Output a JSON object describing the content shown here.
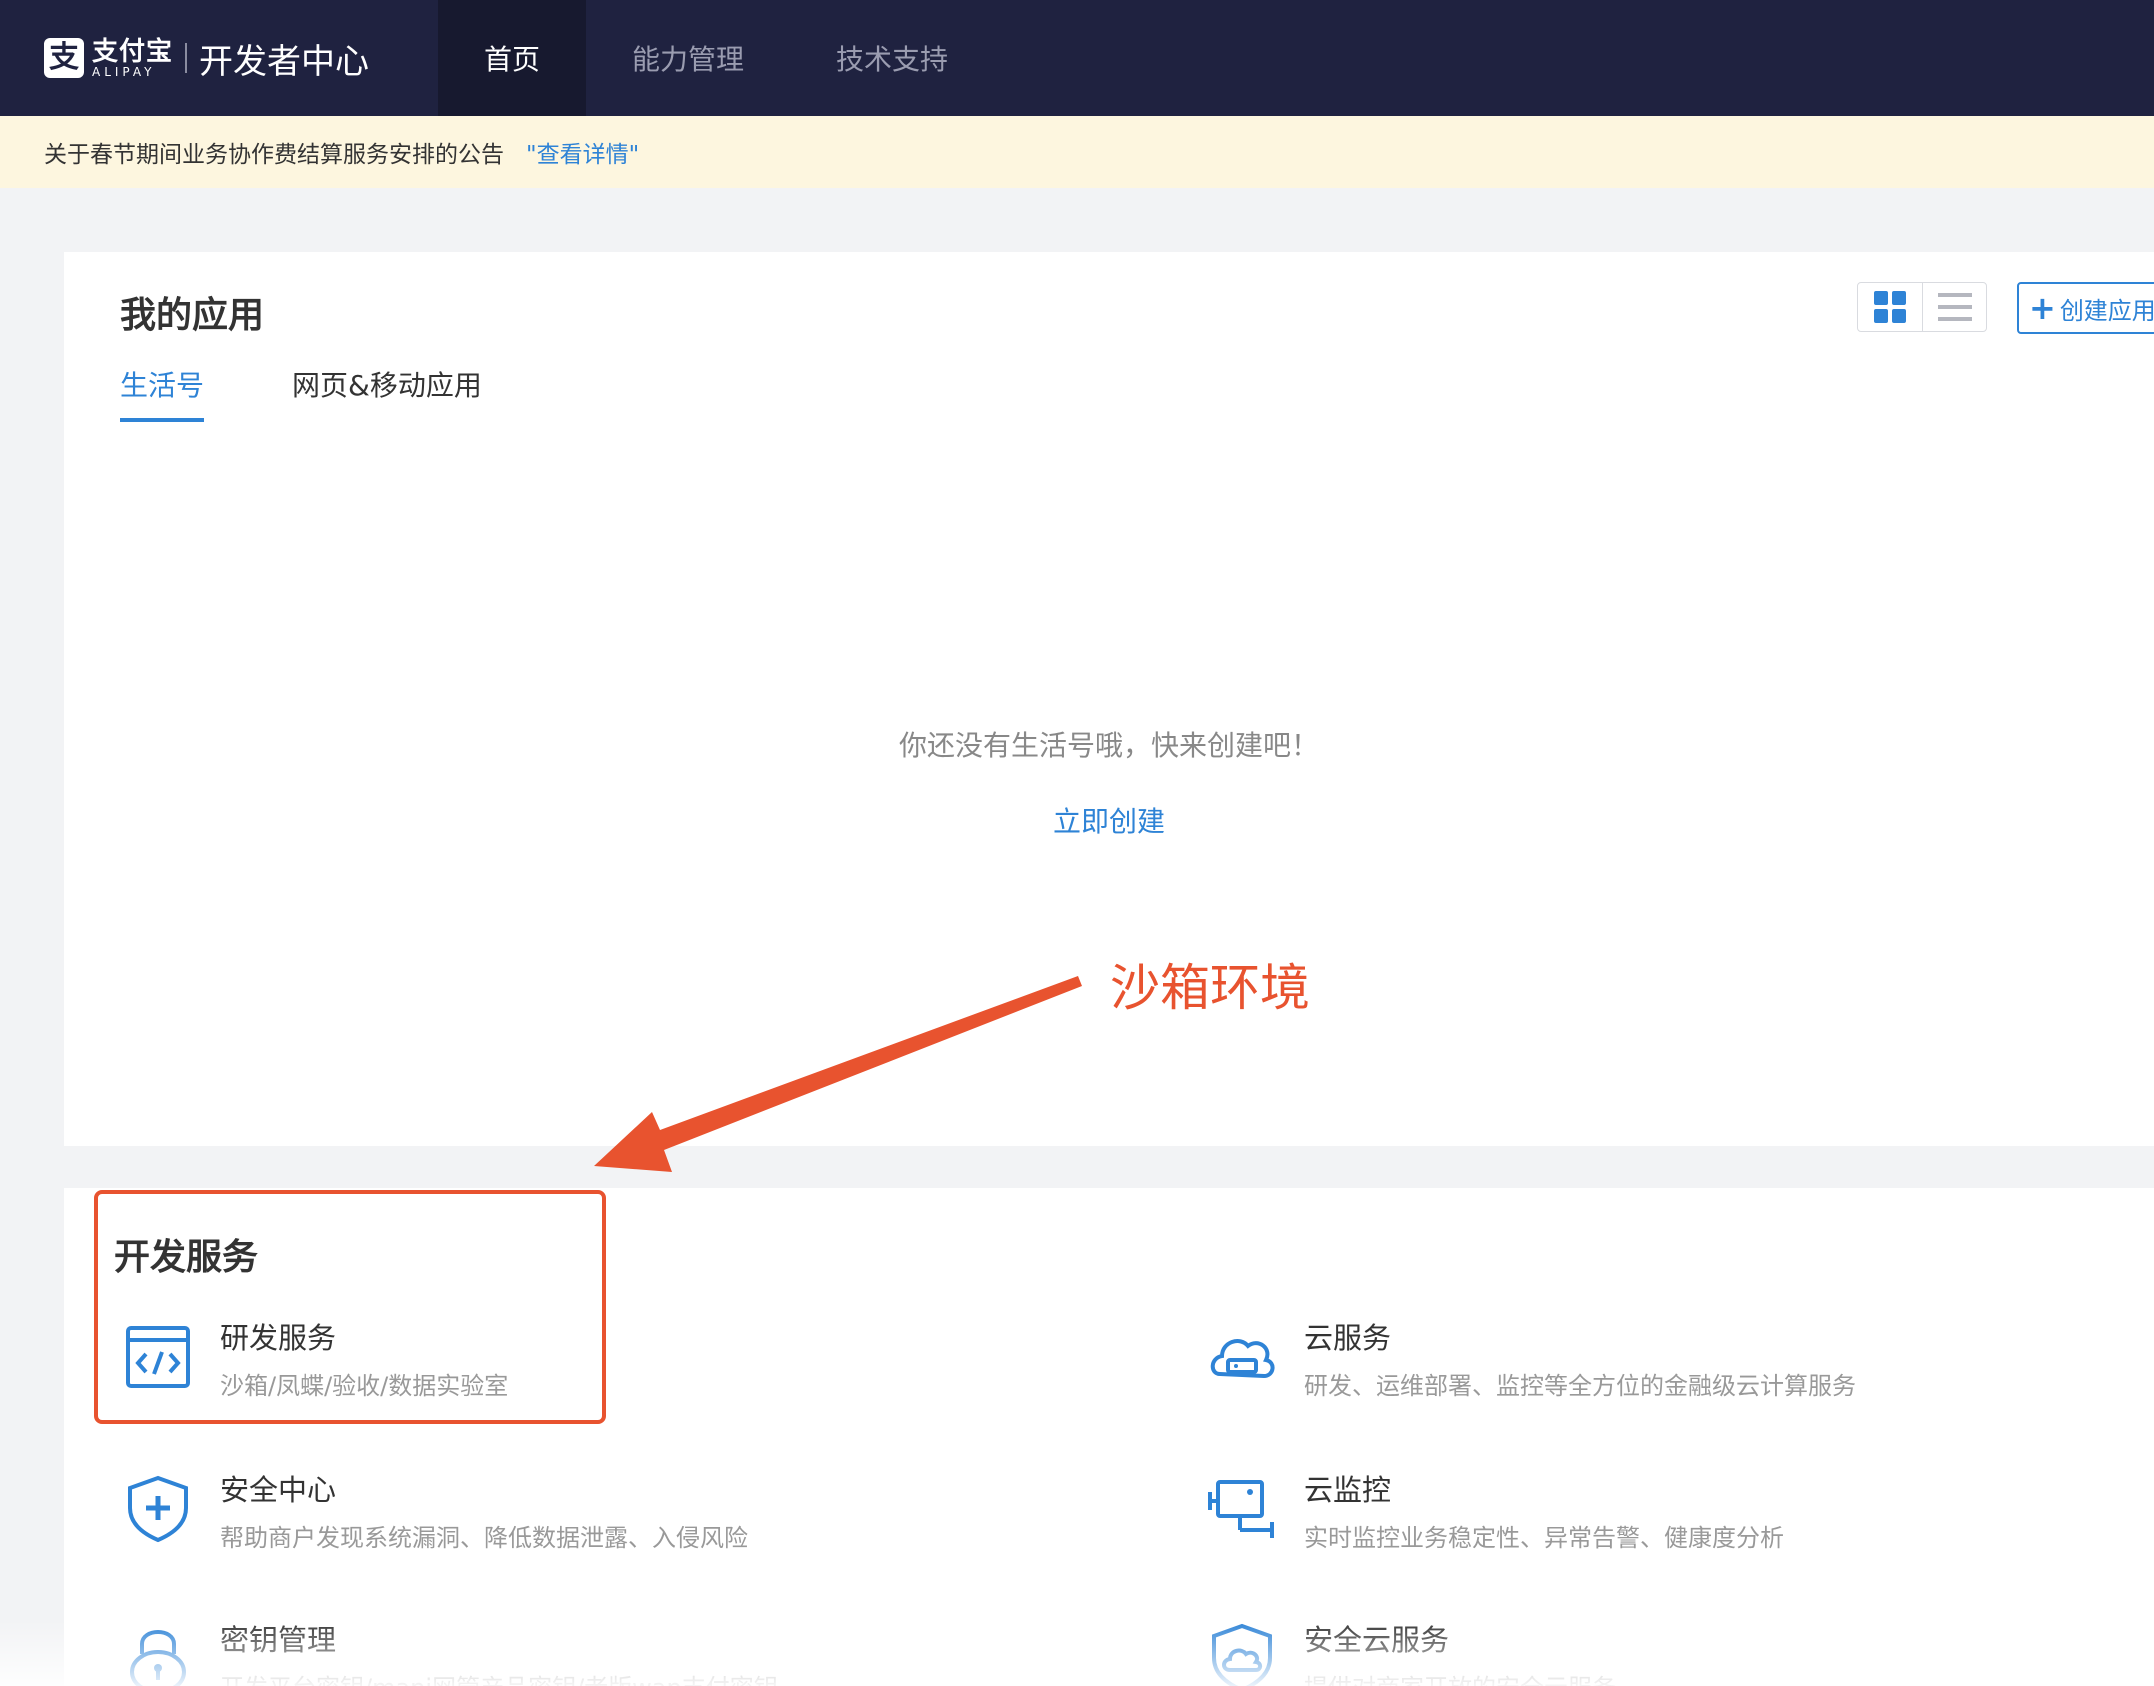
{
  "header": {
    "brand": {
      "logo_glyph": "支",
      "name_cn": "支付宝",
      "name_en": "ALIPAY",
      "title": "开发者中心"
    },
    "tabs": [
      {
        "label": "首页",
        "active": true
      },
      {
        "label": "能力管理",
        "active": false
      },
      {
        "label": "技术支持",
        "active": false
      }
    ]
  },
  "notice": {
    "text": "关于春节期间业务协作费结算服务安排的公告",
    "link": "\"查看详情\""
  },
  "my_apps": {
    "title": "我的应用",
    "tabs": [
      {
        "label": "生活号",
        "active": true
      },
      {
        "label": "网页&移动应用",
        "active": false
      }
    ],
    "view_modes": [
      "grid-icon",
      "list-icon"
    ],
    "create_button": {
      "plus": "+",
      "label": "创建应用"
    },
    "empty_text": "你还没有生活号哦，快来创建吧！",
    "create_now": "立即创建"
  },
  "annotation": {
    "label": "沙箱环境",
    "color": "#e8532f"
  },
  "dev_services": {
    "title": "开发服务",
    "items": [
      {
        "name": "研发服务",
        "desc": "沙箱/凤蝶/验收/数据实验室",
        "icon": "code-window-icon"
      },
      {
        "name": "云服务",
        "desc": "研发、运维部署、监控等全方位的金融级云计算服务",
        "icon": "cloud-server-icon"
      },
      {
        "name": "安全中心",
        "desc": "帮助商户发现系统漏洞、降低数据泄露、入侵风险",
        "icon": "shield-plus-icon"
      },
      {
        "name": "云监控",
        "desc": "实时监控业务稳定性、异常告警、健康度分析",
        "icon": "monitor-camera-icon"
      },
      {
        "name": "密钥管理",
        "desc": "开发平台密钥/mapi网管产品密钥/老版wap支付密钥",
        "icon": "lock-icon"
      },
      {
        "name": "安全云服务",
        "desc": "提供对商家开放的安全云服务",
        "icon": "shield-cloud-icon"
      }
    ]
  },
  "colors": {
    "nav_bg": "#1f2240",
    "accent": "#2e83d6",
    "annotation": "#e8532f",
    "notice_bg": "#fdf6df"
  }
}
